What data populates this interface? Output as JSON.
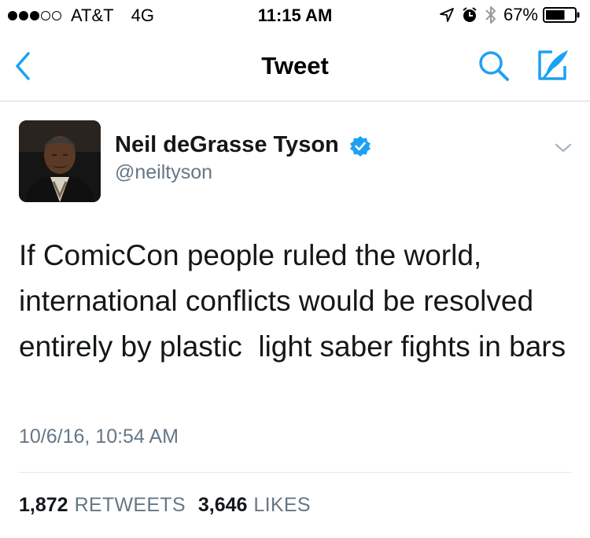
{
  "status_bar": {
    "carrier": "AT&T",
    "network": "4G",
    "time": "11:15 AM",
    "battery": "67%",
    "battery_level": 0.67,
    "signal_bars_filled": 3,
    "signal_bars_total": 5
  },
  "nav": {
    "title": "Tweet"
  },
  "tweet": {
    "author_name": "Neil deGrasse Tyson",
    "author_handle": "@neiltyson",
    "verified": true,
    "text": "If ComicCon people ruled the world, international conflicts would be resolved entirely by plastic  light saber fights in bars",
    "timestamp": "10/6/16, 10:54 AM",
    "retweets_count": "1,872",
    "retweets_label": "RETWEETS",
    "likes_count": "3,646",
    "likes_label": "LIKES"
  },
  "colors": {
    "accent": "#1da1f2",
    "text": "#14171a",
    "secondary_text": "#657786"
  },
  "icons": [
    "location-arrow-icon",
    "alarm-icon",
    "bluetooth-icon",
    "battery-icon",
    "back-chevron-icon",
    "search-icon",
    "compose-icon",
    "verified-badge-icon",
    "caret-down-icon"
  ]
}
